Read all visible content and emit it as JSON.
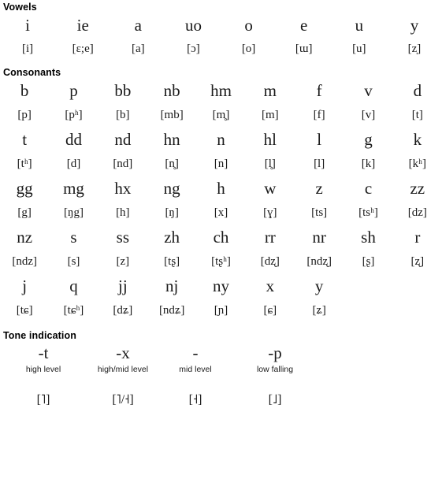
{
  "sections": {
    "vowels": {
      "heading": "Vowels",
      "columns": 8,
      "letters": [
        "i",
        "ie",
        "a",
        "uo",
        "o",
        "e",
        "u",
        "y"
      ],
      "ipa": [
        "[i]",
        "[ɛ;e]",
        "[a]",
        "[ɔ]",
        "[o]",
        "[ɯ]",
        "[u]",
        "[z̩]"
      ]
    },
    "consonants": {
      "heading": "Consonants",
      "columns": 9,
      "rows": [
        {
          "letters": [
            "b",
            "p",
            "bb",
            "nb",
            "hm",
            "m",
            "f",
            "v",
            "d"
          ],
          "ipa": [
            "[p]",
            "[pʰ]",
            "[b]",
            "[mb]",
            "[m̥]",
            "[m]",
            "[f]",
            "[v]",
            "[t]"
          ]
        },
        {
          "letters": [
            "t",
            "dd",
            "nd",
            "hn",
            "n",
            "hl",
            "l",
            "g",
            "k"
          ],
          "ipa": [
            "[tʰ]",
            "[d]",
            "[nd]",
            "[n̥]",
            "[n]",
            "[l̥]",
            "[l]",
            "[k]",
            "[kʰ]"
          ]
        },
        {
          "letters": [
            "gg",
            "mg",
            "hx",
            "ng",
            "h",
            "w",
            "z",
            "c",
            "zz"
          ],
          "ipa": [
            "[g]",
            "[ŋg]",
            "[h]",
            "[ŋ]",
            "[x]",
            "[ɣ]",
            "[ts]",
            "[tsʰ]",
            "[dz]"
          ]
        },
        {
          "letters": [
            "nz",
            "s",
            "ss",
            "zh",
            "ch",
            "rr",
            "nr",
            "sh",
            "r"
          ],
          "ipa": [
            "[ndz]",
            "[s]",
            "[z]",
            "[tʂ]",
            "[tʂʰ]",
            "[dʐ]",
            "[ndʐ]",
            "[ʂ]",
            "[ʐ]"
          ]
        },
        {
          "letters": [
            "j",
            "q",
            "jj",
            "nj",
            "ny",
            "x",
            "y",
            "",
            ""
          ],
          "ipa": [
            "[tɕ]",
            "[tɕʰ]",
            "[dʑ]",
            "[ndʑ]",
            "[ɲ]",
            "[ɕ]",
            "[ʑ]",
            "",
            ""
          ]
        }
      ]
    },
    "tone": {
      "heading": "Tone indication",
      "columns": 4,
      "marks": [
        "-t",
        "-x",
        "-",
        "-p"
      ],
      "descriptions": [
        "high level",
        "high/mid level",
        "mid level",
        "low falling"
      ],
      "tone_letters": [
        "[˥]",
        "[˥/˧]",
        "[˧]",
        "[˩]"
      ]
    }
  },
  "colors": {
    "background": "#ffffff",
    "text": "#1a1a1a",
    "heading": "#000000"
  }
}
